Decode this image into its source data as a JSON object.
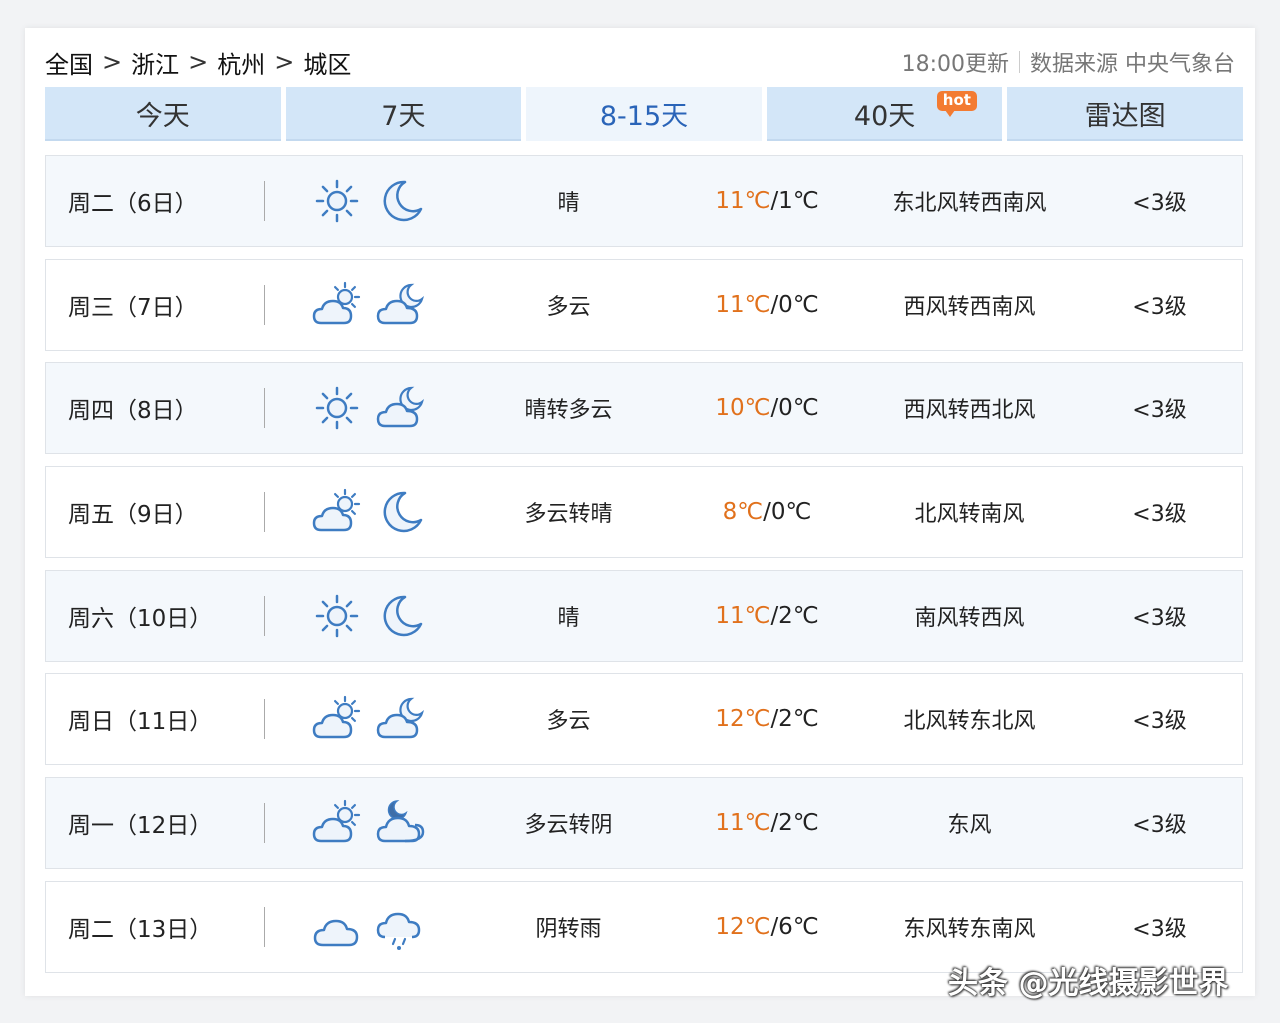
{
  "breadcrumb": {
    "country": "全国",
    "province": "浙江",
    "city": "杭州",
    "district": "城区",
    "separator": ">"
  },
  "meta": {
    "update": "18:00更新",
    "source": "数据来源 中央气象台"
  },
  "tabs": [
    {
      "label": "今天"
    },
    {
      "label": "7天"
    },
    {
      "label": "8-15天",
      "active": true
    },
    {
      "label": "40天",
      "badge": "hot"
    },
    {
      "label": "雷达图"
    }
  ],
  "colors": {
    "accent": "#2a64b8",
    "hi_temp": "#e1711c",
    "tab_bg": "#d3e6f8",
    "hot_badge": "#f37b32"
  },
  "forecast": [
    {
      "day": "周二（6日）",
      "icon_day": "sun-icon",
      "icon_night": "moon-icon",
      "cond": "晴",
      "hi": "11℃",
      "lo": "/1℃",
      "wind": "东北风转西南风",
      "level": "<3级"
    },
    {
      "day": "周三（7日）",
      "icon_day": "cloud-sun-icon",
      "icon_night": "cloud-moon-icon",
      "cond": "多云",
      "hi": "11℃",
      "lo": "/0℃",
      "wind": "西风转西南风",
      "level": "<3级"
    },
    {
      "day": "周四（8日）",
      "icon_day": "sun-icon",
      "icon_night": "cloud-moon-icon",
      "cond": "晴转多云",
      "hi": "10℃",
      "lo": "/0℃",
      "wind": "西风转西北风",
      "level": "<3级"
    },
    {
      "day": "周五（9日）",
      "icon_day": "cloud-sun-icon",
      "icon_night": "moon-icon",
      "cond": "多云转晴",
      "hi": "8℃",
      "lo": "/0℃",
      "wind": "北风转南风",
      "level": "<3级"
    },
    {
      "day": "周六（10日）",
      "icon_day": "sun-icon",
      "icon_night": "moon-icon",
      "cond": "晴",
      "hi": "11℃",
      "lo": "/2℃",
      "wind": "南风转西风",
      "level": "<3级"
    },
    {
      "day": "周日（11日）",
      "icon_day": "cloud-sun-icon",
      "icon_night": "cloud-moon-icon",
      "cond": "多云",
      "hi": "12℃",
      "lo": "/2℃",
      "wind": "北风转东北风",
      "level": "<3级"
    },
    {
      "day": "周一（12日）",
      "icon_day": "cloud-sun-icon",
      "icon_night": "overcast-moon-icon",
      "cond": "多云转阴",
      "hi": "11℃",
      "lo": "/2℃",
      "wind": "东风",
      "level": "<3级"
    },
    {
      "day": "周二（13日）",
      "icon_day": "overcast-icon",
      "icon_night": "rain-icon",
      "cond": "阴转雨",
      "hi": "12℃",
      "lo": "/6℃",
      "wind": "东风转东南风",
      "level": "<3级"
    }
  ],
  "watermark": "头条 @光线摄影世界"
}
